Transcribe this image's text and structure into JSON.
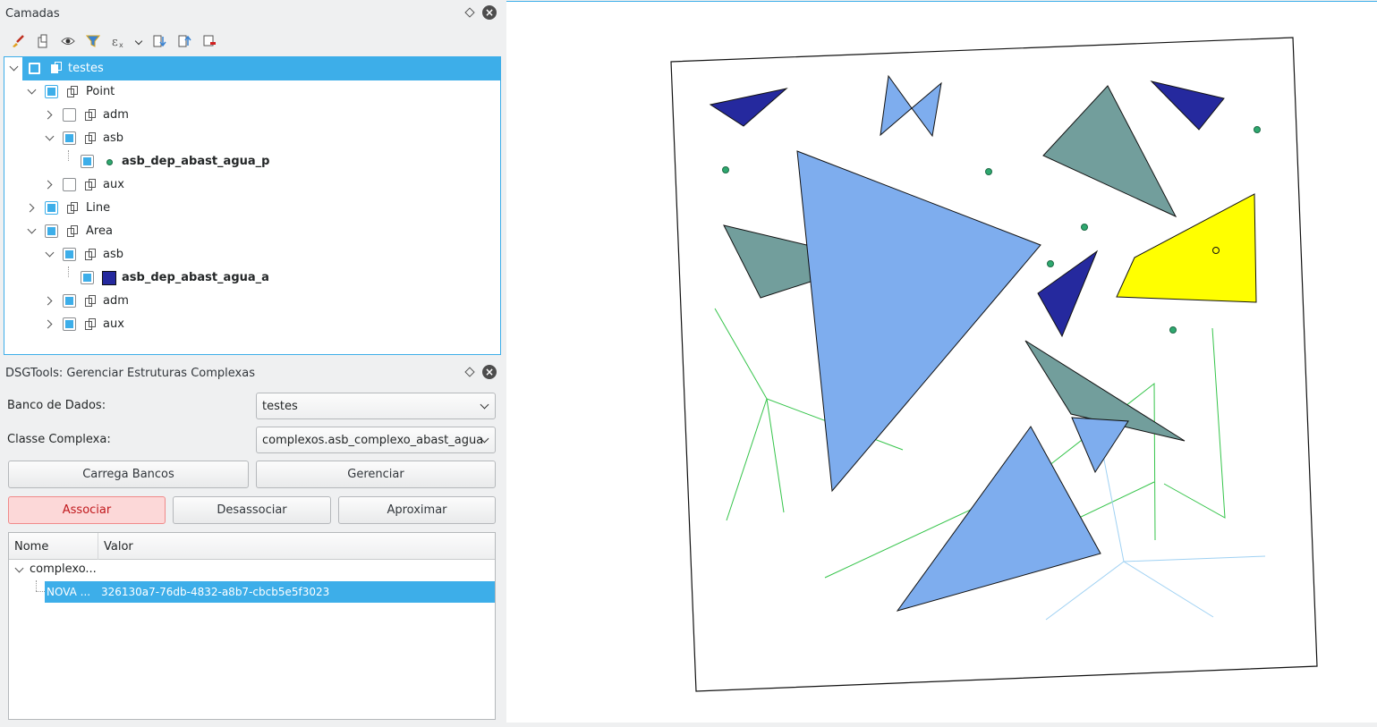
{
  "layers_panel": {
    "title": "Camadas",
    "tree": [
      {
        "label": "testes"
      },
      {
        "label": "Point"
      },
      {
        "label": "adm"
      },
      {
        "label": "asb"
      },
      {
        "label": "asb_dep_abast_agua_p"
      },
      {
        "label": "aux"
      },
      {
        "label": "Line"
      },
      {
        "label": "Area"
      },
      {
        "label": "asb"
      },
      {
        "label": "asb_dep_abast_agua_a"
      },
      {
        "label": "adm"
      },
      {
        "label": "aux"
      }
    ]
  },
  "dsg_panel": {
    "title": "DSGTools: Gerenciar Estruturas Complexas",
    "db_label": "Banco de Dados:",
    "db_value": "testes",
    "class_label": "Classe Complexa:",
    "class_value": "complexos.asb_complexo_abast_agua",
    "load_button": "Carrega Bancos",
    "manage_button": "Gerenciar",
    "associate_button": "Associar",
    "disassociate_button": "Desassociar",
    "zoom_button": "Aproximar",
    "table": {
      "col_name": "Nome",
      "col_value": "Valor",
      "parent": "complexo...",
      "child_name": "NOVA ...",
      "child_value": "326130a7-76db-4832-a8b7-cbcb5e5f3023"
    }
  },
  "colors": {
    "accent": "#3daee9",
    "polygon_light": "#7eadee",
    "polygon_dark": "#25299e",
    "polygon_gray": "#729e9c",
    "polygon_yellow": "#ffff00",
    "point_green": "#2ea86f",
    "line_green": "#35c44a",
    "line_light_blue": "#9fd1f3"
  }
}
